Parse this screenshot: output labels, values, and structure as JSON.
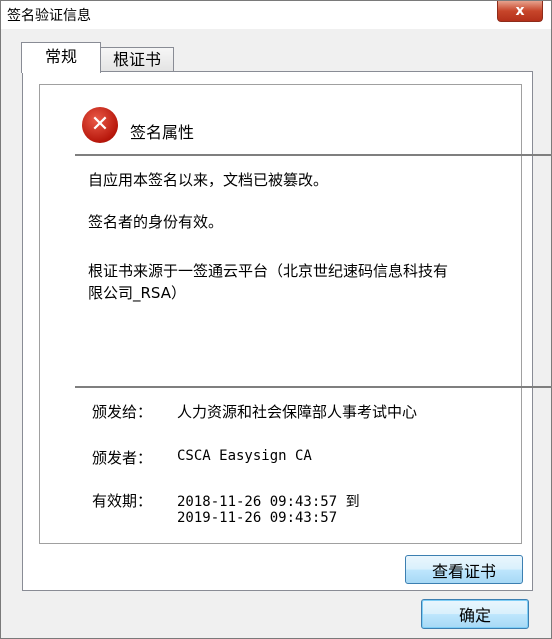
{
  "window": {
    "title": "签名验证信息",
    "close_glyph": "x"
  },
  "tabs": [
    {
      "label": "常规",
      "active": true
    },
    {
      "label": "根证书",
      "active": false
    }
  ],
  "signature": {
    "icon": "error-x-icon",
    "heading": "签名属性",
    "messages": [
      "自应用本签名以来，文档已被篡改。",
      "签名者的身份有效。",
      "根证书来源于一签通云平台（北京世纪速码信息科技有",
      "限公司_RSA）"
    ]
  },
  "details": {
    "issued_to_label": "颁发给：",
    "issued_to_value": "人力资源和社会保障部人事考试中心",
    "issuer_label": "颁发者：",
    "issuer_value": "CSCA Easysign CA",
    "validity_label": "有效期：",
    "validity_line1": "2018-11-26 09:43:57 到",
    "validity_line2": "2019-11-26 09:43:57"
  },
  "buttons": {
    "view_cert": "查看证书",
    "ok": "确定"
  },
  "colors": {
    "error_red": "#c0180c",
    "close_button": "#c7452a",
    "button_blue": "#bee6fd"
  }
}
